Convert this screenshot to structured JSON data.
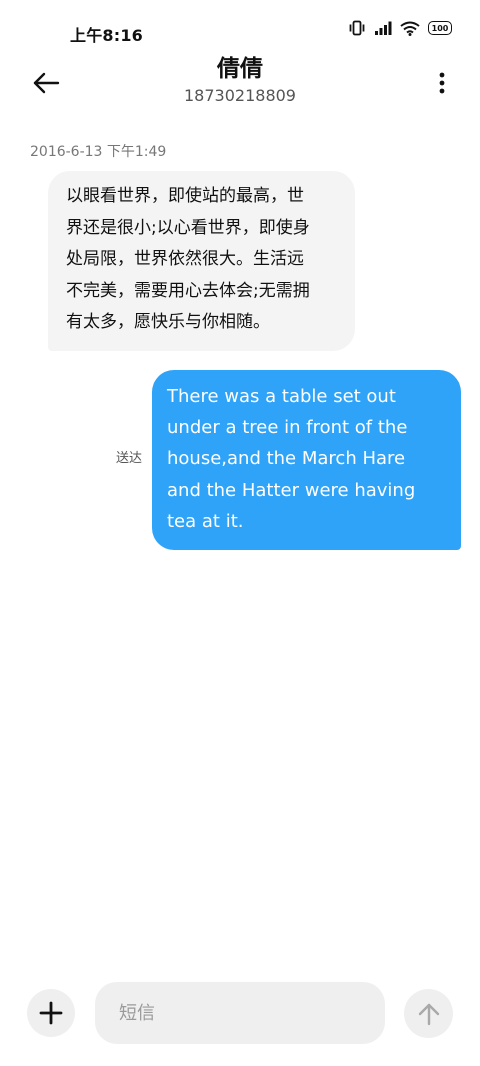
{
  "status_bar": {
    "time": "上午8:16",
    "battery_level": "100",
    "icons": [
      "vibrate-icon",
      "signal-icon",
      "wifi-icon",
      "battery-icon"
    ]
  },
  "header": {
    "contact_name": "倩倩",
    "contact_number": "18730218809",
    "icons": [
      "back-arrow-icon",
      "more-vert-icon"
    ]
  },
  "conversation": {
    "timestamp": "2016-6-13 下午1:49",
    "incoming": {
      "text": "以眼看世界，即使站的最高，世\n界还是很小;以心看世界，即使身\n处局限，世界依然很大。生活远\n不完美，需要用心去体会;无需拥\n有太多，愿快乐与你相随。"
    },
    "outgoing": {
      "text": "There was a table set out\nunder a tree in front of the\nhouse,and the March Hare\nand the Hatter were having\ntea at it.",
      "status": "送达"
    }
  },
  "composer": {
    "placeholder": "短信",
    "value": "",
    "icons": [
      "plus-icon",
      "send-arrow-icon"
    ]
  },
  "colors": {
    "outgoing_bubble": "#2ea3f8",
    "incoming_bubble": "#f4f4f4",
    "control_background": "#efefef"
  }
}
